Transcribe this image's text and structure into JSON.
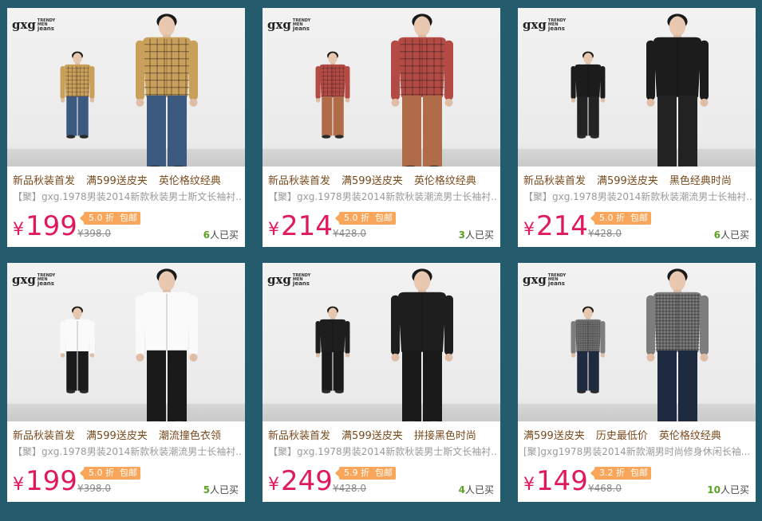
{
  "brand": {
    "logo": "gxg",
    "logo_sub": [
      "TRENDY",
      "MEN",
      "jeans"
    ]
  },
  "products": [
    {
      "slogans": [
        "新品秋装首发",
        "满599送皮夹",
        "英伦格纹经典"
      ],
      "title": "【聚】gxg.1978男装2014新款秋装男士斯文长袖衬...",
      "currency": "¥",
      "price": "199",
      "discount": "5.0 折",
      "free_shipping": "包邮",
      "original_price": "¥398.0",
      "buyers_count": "6",
      "buyers_suffix": "人已买",
      "outfit": {
        "shirt": "#c9a05a",
        "pants": "#3c5a80",
        "pattern": "plaid"
      }
    },
    {
      "slogans": [
        "新品秋装首发",
        "满599送皮夹",
        "英伦格纹经典"
      ],
      "title": "【聚】gxg.1978男装2014新款秋装潮流男士长袖衬...",
      "currency": "¥",
      "price": "214",
      "discount": "5.0 折",
      "free_shipping": "包邮",
      "original_price": "¥428.0",
      "buyers_count": "3",
      "buyers_suffix": "人已买",
      "outfit": {
        "shirt": "#b44a44",
        "pants": "#b06c48",
        "pattern": "plaid"
      }
    },
    {
      "slogans": [
        "新品秋装首发",
        "满599送皮夹",
        "黑色经典时尚"
      ],
      "title": "【聚】gxg.1978男装2014新款秋装潮流男士长袖衬...",
      "currency": "¥",
      "price": "214",
      "discount": "5.0 折",
      "free_shipping": "包邮",
      "original_price": "¥428.0",
      "buyers_count": "6",
      "buyers_suffix": "人已买",
      "outfit": {
        "shirt": "#1c1c1c",
        "pants": "#222222",
        "pattern": "solid"
      }
    },
    {
      "slogans": [
        "新品秋装首发",
        "满599送皮夹",
        "潮流撞色衣领"
      ],
      "title": "【聚】gxg.1978男装2014新款秋装潮流男士长袖衬...",
      "currency": "¥",
      "price": "199",
      "discount": "5.0 折",
      "free_shipping": "包邮",
      "original_price": "¥398.0",
      "buyers_count": "5",
      "buyers_suffix": "人已买",
      "outfit": {
        "shirt": "#fafafa",
        "pants": "#1a1a1a",
        "pattern": "solid"
      }
    },
    {
      "slogans": [
        "新品秋装首发",
        "满599送皮夹",
        "拼接黑色时尚"
      ],
      "title": "【聚】gxg.1978男装2014新款秋装男士斯文长袖衬...",
      "currency": "¥",
      "price": "249",
      "discount": "5.9 折",
      "free_shipping": "包邮",
      "original_price": "¥428.0",
      "buyers_count": "4",
      "buyers_suffix": "人已买",
      "outfit": {
        "shirt": "#1e1e1e",
        "pants": "#1a1a1a",
        "pattern": "solid"
      }
    },
    {
      "slogans": [
        "满599送皮夹",
        "历史最低价",
        "英伦格纹经典"
      ],
      "title": "[聚]gxg1978男装2014新款潮男时尚修身休闲长袖...",
      "currency": "¥",
      "price": "149",
      "discount": "3.2 折",
      "free_shipping": "包邮",
      "original_price": "¥468.0",
      "buyers_count": "10",
      "buyers_suffix": "人已买",
      "outfit": {
        "shirt": "#7d7d7d",
        "pants": "#1e2a40",
        "pattern": "check"
      }
    }
  ]
}
